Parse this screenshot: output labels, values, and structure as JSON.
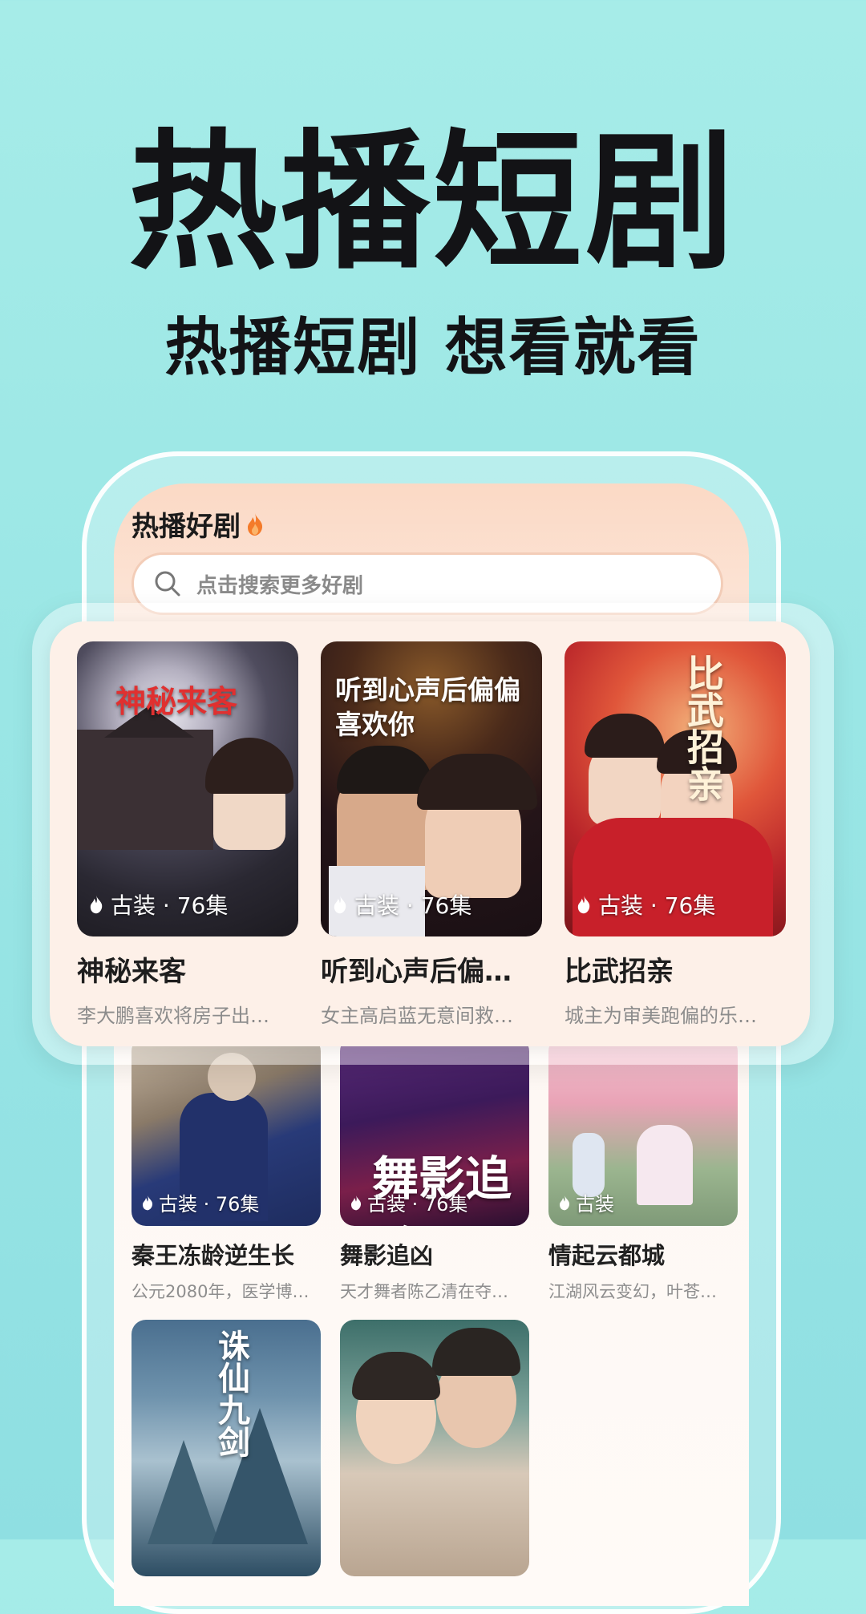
{
  "hero": {
    "title": "热播短剧",
    "subtitle": "热播短剧 想看就看"
  },
  "app": {
    "section_title": "热播好剧",
    "search_placeholder": "点击搜索更多好剧"
  },
  "highlight_cards": [
    {
      "title": "神秘来客",
      "tag": "古装 · 76集",
      "desc": "李大鹏喜欢将房子出…",
      "poster_text": "神秘来客"
    },
    {
      "title": "听到心声后偏…",
      "tag": "古装 · 76集",
      "desc": "女主高启蓝无意间救…",
      "poster_text": "听到心声后偏偏喜欢你"
    },
    {
      "title": "比武招亲",
      "tag": "古装 · 76集",
      "desc": "城主为审美跑偏的乐…",
      "poster_text": "比武招亲"
    }
  ],
  "grid_cards": [
    {
      "title": "秦王冻龄逆生长",
      "tag": "古装 · 76集",
      "desc": "公元2080年，医学博…"
    },
    {
      "title": "舞影追凶",
      "tag": "古装 · 76集",
      "desc": "天才舞者陈乙清在夺…",
      "poster_text": "舞影追凶"
    },
    {
      "title": "情起云都城",
      "tag": "古装",
      "desc": "江湖风云变幻，叶苍…"
    },
    {
      "title": "",
      "tag": "",
      "desc": "",
      "poster_text": "诛仙九剑"
    },
    {
      "title": "",
      "tag": "",
      "desc": ""
    }
  ],
  "colors": {
    "background": "#9ae6e5",
    "flame": "#f47b2a"
  }
}
